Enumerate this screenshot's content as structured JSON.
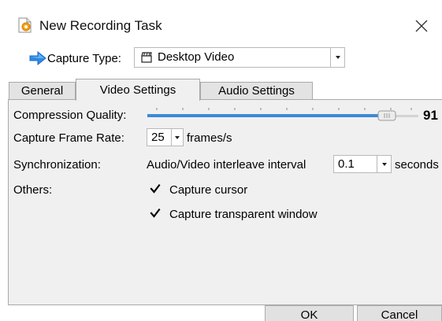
{
  "window": {
    "title": "New Recording Task",
    "close_icon": "close-icon"
  },
  "capture": {
    "label": "Capture Type:",
    "selected": "Desktop Video",
    "icon": "clapperboard-icon"
  },
  "tabs": [
    {
      "label": "General",
      "active": false
    },
    {
      "label": "Video Settings",
      "active": true
    },
    {
      "label": "Audio Settings",
      "active": false
    }
  ],
  "video_settings": {
    "compression_label": "Compression Quality:",
    "compression_value": "91",
    "compression_level_percent": 91,
    "frame_rate_label": "Capture Frame Rate:",
    "frame_rate_value": "25",
    "frame_rate_unit": "frames/s",
    "sync_label": "Synchronization:",
    "interleave_label": "Audio/Video interleave interval",
    "interleave_value": "0.1",
    "interleave_unit": "seconds",
    "others_label": "Others:",
    "capture_cursor_label": "Capture cursor",
    "capture_cursor_checked": true,
    "capture_transparent_label": "Capture transparent window",
    "capture_transparent_checked": true
  },
  "buttons": {
    "ok": "OK",
    "cancel": "Cancel"
  },
  "colors": {
    "slider_fill": "#3c8ad6",
    "arrow_blue": "#2d8ae8",
    "tab_bg": "#e3e3e3",
    "panel_bg": "#f0f0f0"
  }
}
